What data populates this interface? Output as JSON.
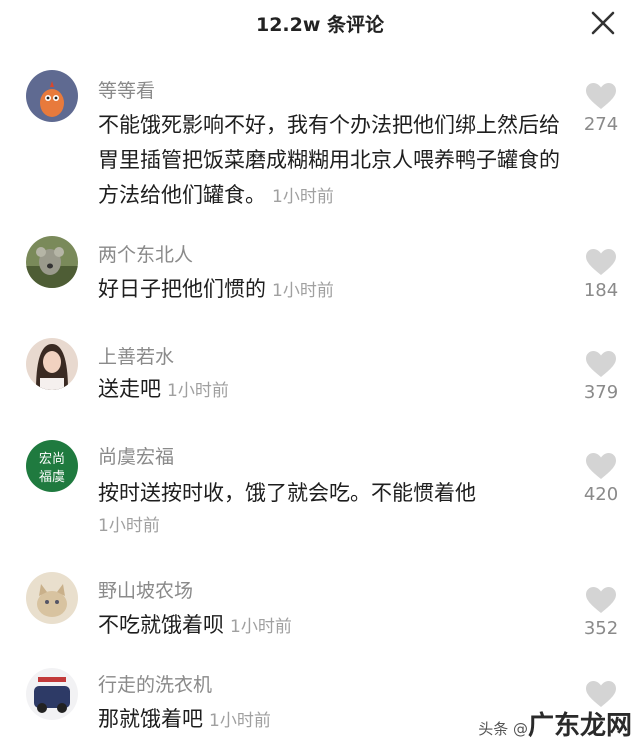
{
  "header": {
    "title": "12.2w 条评论",
    "close_icon": "close-icon"
  },
  "comments": [
    {
      "user": "等等看",
      "text": "不能饿死影响不好，我有个办法把他们绑上然后给胃里插管把饭菜磨成糊糊用北京人喂养鸭子罐食的方法给他们罐食。",
      "time": "1小时前",
      "likes": "274"
    },
    {
      "user": "两个东北人",
      "text": "好日子把他们惯的",
      "time": "1小时前",
      "likes": "184"
    },
    {
      "user": "上善若水",
      "text": "送走吧",
      "time": "1小时前",
      "likes": "379"
    },
    {
      "user": "尚虞宏福",
      "text": "按时送按时收，饿了就会吃。不能惯着他",
      "time": "1小时前",
      "likes": "420",
      "avatar_text": "宏尚福虞"
    },
    {
      "user": "野山坡农场",
      "text": "不吃就饿着呗",
      "time": "1小时前",
      "likes": "352"
    },
    {
      "user": "行走的洗衣机",
      "text": "那就饿着吧",
      "time": "1小时前",
      "likes": ""
    }
  ],
  "watermark": {
    "prefix": "头条 @",
    "brand": "广东龙网"
  },
  "colors": {
    "heart": "#d4d4d4",
    "username": "#8a8a8a",
    "time": "#a0a0a0"
  }
}
